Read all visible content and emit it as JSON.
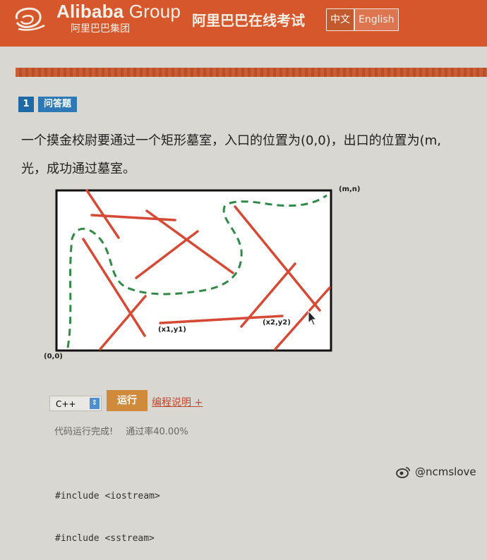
{
  "header": {
    "brand": "Alibaba",
    "brand_group": "Group",
    "brand_sub": "阿里巴巴集团",
    "exam_title": "阿里巴巴在线考试",
    "lang_options": [
      "中文",
      "English"
    ],
    "selected_lang": "中文",
    "colors": {
      "header_bg": "#d7572c",
      "accent_blue": "#1d6aa7"
    }
  },
  "question": {
    "number": "1",
    "type": "问答题",
    "line1": "一个摸金校尉要通过一个矩形墓室，入口的位置为(0,0)，出口的位置为(m,",
    "line2": "光，成功通过墓室。"
  },
  "diagram": {
    "labels": {
      "top_right": "(m,n)",
      "bottom_left": "(0,0)",
      "point1": "(x1,y1)",
      "point2": "(x2,y2)"
    },
    "colors": {
      "laser": "#d64a35",
      "path": "#2f8a45",
      "border": "#111111"
    }
  },
  "editor": {
    "language": "C++",
    "run_button": "运行",
    "help_link": "编程说明 +",
    "status_text": "代码运行完成!",
    "pass_rate": "通过率40.00%",
    "code_lines": [
      "#include <iostream>",
      "#include <sstream>"
    ]
  },
  "watermark": {
    "handle": "@ncmslove",
    "icon": "weibo-icon"
  }
}
